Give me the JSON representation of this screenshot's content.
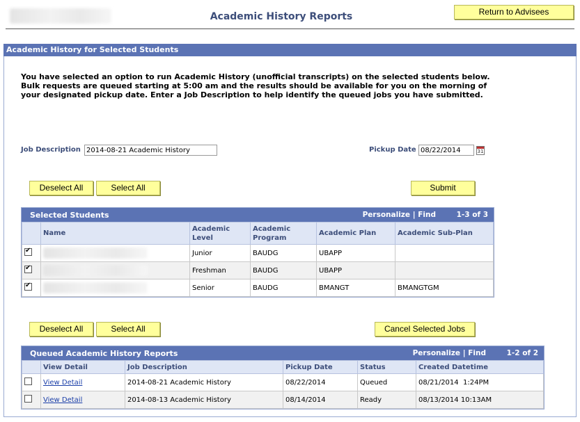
{
  "header": {
    "title": "Academic History Reports",
    "return_button": "Return to Advisees"
  },
  "section": {
    "title": "Academic History for Selected Students",
    "intro": "You have selected an option to run Academic History (unofficial transcripts) on the selected students below. Bulk requests are queued starting at 5:00 am and the results should be available for you on the morning of your designated pickup date. Enter a Job Description to help identify the queued jobs you have submitted."
  },
  "form": {
    "job_description_label": "Job Description",
    "job_description_value": "2014-08-21 Academic History",
    "pickup_date_label": "Pickup Date",
    "pickup_date_value": "08/22/2014",
    "calendar_glyph": "31"
  },
  "buttons": {
    "deselect_all": "Deselect All",
    "select_all": "Select All",
    "submit": "Submit",
    "cancel_selected_jobs": "Cancel Selected Jobs"
  },
  "selected_students": {
    "title": "Selected Students",
    "personalize": "Personalize",
    "find": "Find",
    "range": "1-3 of 3",
    "columns": [
      "Name",
      "Academic Level",
      "Academic Program",
      "Academic Plan",
      "Academic Sub-Plan"
    ],
    "rows": [
      {
        "checked": true,
        "level": "Junior",
        "program": "BAUDG",
        "plan": "UBAPP",
        "subplan": ""
      },
      {
        "checked": true,
        "level": "Freshman",
        "program": "BAUDG",
        "plan": "UBAPP",
        "subplan": ""
      },
      {
        "checked": true,
        "level": "Senior",
        "program": "BAUDG",
        "plan": "BMANGT",
        "subplan": "BMANGTGM"
      }
    ]
  },
  "queued_reports": {
    "title": "Queued Academic History Reports",
    "personalize": "Personalize",
    "find": "Find",
    "range": "1-2 of 2",
    "columns": [
      "View Detail",
      "Job Description",
      "Pickup Date",
      "Status",
      "Created Datetime"
    ],
    "rows": [
      {
        "checked": false,
        "link": "View Detail",
        "job": "2014-08-21 Academic History",
        "pickup": "08/22/2014",
        "status": "Queued",
        "created": "08/21/2014  1:24PM"
      },
      {
        "checked": false,
        "link": "View Detail",
        "job": "2014-08-13 Academic History",
        "pickup": "08/14/2014",
        "status": "Ready",
        "created": "08/13/2014 10:13AM"
      }
    ]
  }
}
